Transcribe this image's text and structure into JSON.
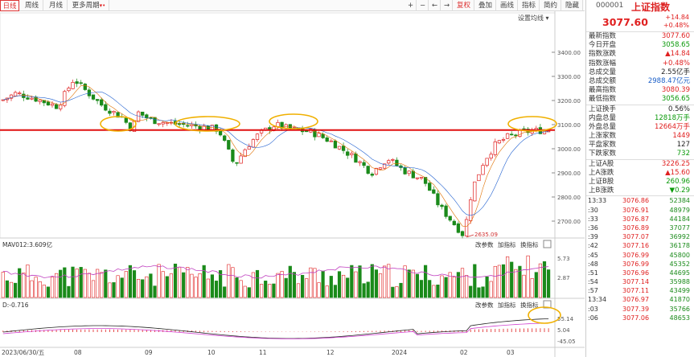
{
  "toolbar": {
    "tabs": [
      "日线",
      "周线",
      "月线",
      "更多周期"
    ],
    "right": [
      "+",
      "−",
      "←",
      "→",
      "复权",
      "叠加",
      "画线",
      "指标",
      "简约",
      "隐藏"
    ],
    "set_ma": "设置均线"
  },
  "panel": {
    "code": "000001",
    "name": "上证指数",
    "price": "3077.60",
    "change": "+14.84",
    "change_pct": "+0.48%",
    "stats1": [
      {
        "l": "最新指数",
        "v": "3077.60",
        "c": "red"
      },
      {
        "l": "今日开盘",
        "v": "3058.65",
        "c": "green"
      },
      {
        "l": "指数涨跌",
        "v": "▲14.84",
        "c": "red"
      },
      {
        "l": "指数涨幅",
        "v": "+0.48%",
        "c": "red"
      },
      {
        "l": "总成交量",
        "v": "2.55亿手",
        "c": "blk"
      },
      {
        "l": "总成交额",
        "v": "2988.47亿元",
        "c": "blue"
      },
      {
        "l": "最高指数",
        "v": "3080.39",
        "c": "red"
      },
      {
        "l": "最低指数",
        "v": "3056.65",
        "c": "green"
      }
    ],
    "stats2": [
      {
        "l": "上证换手",
        "v": "0.56%",
        "c": "blk"
      },
      {
        "l": "内盘总量",
        "v": "12818万手",
        "c": "green"
      },
      {
        "l": "外盘总量",
        "v": "12664万手",
        "c": "red"
      },
      {
        "l": "上涨家数",
        "v": "1449",
        "c": "red"
      },
      {
        "l": "平盘家数",
        "v": "127",
        "c": "blk"
      },
      {
        "l": "下跌家数",
        "v": "732",
        "c": "green"
      }
    ],
    "stats3": [
      {
        "l": "上证A股",
        "v": "3226.25",
        "c": "red"
      },
      {
        "l": "上A涨跌",
        "v": "▲15.60",
        "c": "red"
      },
      {
        "l": "上证B股",
        "v": "260.96",
        "c": "green"
      },
      {
        "l": "上B涨跌",
        "v": "▼0.29",
        "c": "green"
      }
    ],
    "ticks": [
      {
        "t": "13:33",
        "p": "3076.86",
        "q": "52384"
      },
      {
        "t": ":30",
        "p": "3076.91",
        "q": "48979"
      },
      {
        "t": ":33",
        "p": "3076.87",
        "q": "44184"
      },
      {
        "t": ":36",
        "p": "3076.89",
        "q": "37077"
      },
      {
        "t": ":39",
        "p": "3077.07",
        "q": "36992"
      },
      {
        "t": ":42",
        "p": "3077.16",
        "q": "36178"
      },
      {
        "t": ":45",
        "p": "3076.99",
        "q": "45800"
      },
      {
        "t": ":48",
        "p": "3076.99",
        "q": "45352"
      },
      {
        "t": ":51",
        "p": "3076.96",
        "q": "44695"
      },
      {
        "t": ":54",
        "p": "3077.14",
        "q": "35988"
      },
      {
        "t": ":57",
        "p": "3077.11",
        "q": "43499"
      },
      {
        "t": "13:34",
        "p": "3076.97",
        "q": "41870"
      },
      {
        "t": ":03",
        "p": "3077.39",
        "q": "35766"
      },
      {
        "t": ":06",
        "p": "3077.06",
        "q": "48653"
      }
    ]
  },
  "price_axis": [
    "3400.00",
    "3300.00",
    "3200.00",
    "3100.00",
    "3000.00",
    "2900.00",
    "2800.00",
    "2700.00"
  ],
  "vol": {
    "label": "MAV012:3.609亿",
    "axis": [
      "5.73",
      "2.87"
    ],
    "buttons": [
      "改参数",
      "加指标",
      "换指标"
    ]
  },
  "macd": {
    "label": "D:-0.716",
    "axis": [
      "55.14",
      "5.04",
      "-45.05"
    ],
    "buttons": [
      "改参数",
      "加指标",
      "换指标"
    ]
  },
  "low_label": "2635.09",
  "dates": [
    "2023/06/30/五",
    "08",
    "09",
    "10",
    "11",
    "12",
    "2024",
    "02",
    "03"
  ]
}
